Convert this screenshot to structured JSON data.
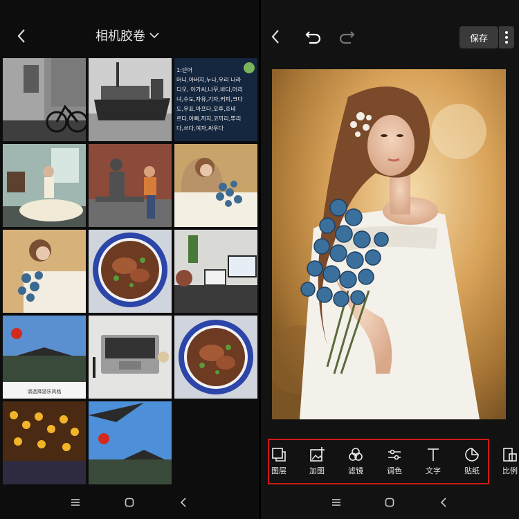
{
  "left_panel": {
    "album_title": "相机胶卷",
    "thumb_banner_text": "请选择游乐风格",
    "korean_note": {
      "lines": [
        "1:단어",
        "머니,아버지,누나,우리 나라",
        "디오, 아가씨,나무,바다,머리",
        "녀,수도,자유,기자,커피,크다",
        "도,우표,아프다,오후,흐네",
        "르다,아빠,까치,코끼리,뿌리",
        "다,쓰다,여자,싸우다"
      ]
    },
    "thumbnails": [
      {
        "name": "bicycle-street"
      },
      {
        "name": "cargo-ship"
      },
      {
        "name": "korean-notes"
      },
      {
        "name": "bride-room"
      },
      {
        "name": "statue-bench"
      },
      {
        "name": "bride-flowers"
      },
      {
        "name": "bride-flowers-crop"
      },
      {
        "name": "noodle-bowl"
      },
      {
        "name": "office-laptop"
      },
      {
        "name": "festival-lanterns"
      },
      {
        "name": "laptop-desk"
      },
      {
        "name": "noodle-bowl-2"
      },
      {
        "name": "lantern-street"
      },
      {
        "name": "pagoda-sky"
      }
    ]
  },
  "right_panel": {
    "save_label": "保存",
    "tools": [
      {
        "label": "图层",
        "icon": "layers-icon"
      },
      {
        "label": "加图",
        "icon": "add-image-icon"
      },
      {
        "label": "滤镜",
        "icon": "filter-icon"
      },
      {
        "label": "调色",
        "icon": "adjust-icon"
      },
      {
        "label": "文字",
        "icon": "text-icon"
      },
      {
        "label": "贴纸",
        "icon": "sticker-icon"
      },
      {
        "label": "比例",
        "icon": "ratio-icon"
      }
    ]
  },
  "colors": {
    "highlight": "#d01818",
    "save_bg": "#3a3a3a"
  }
}
